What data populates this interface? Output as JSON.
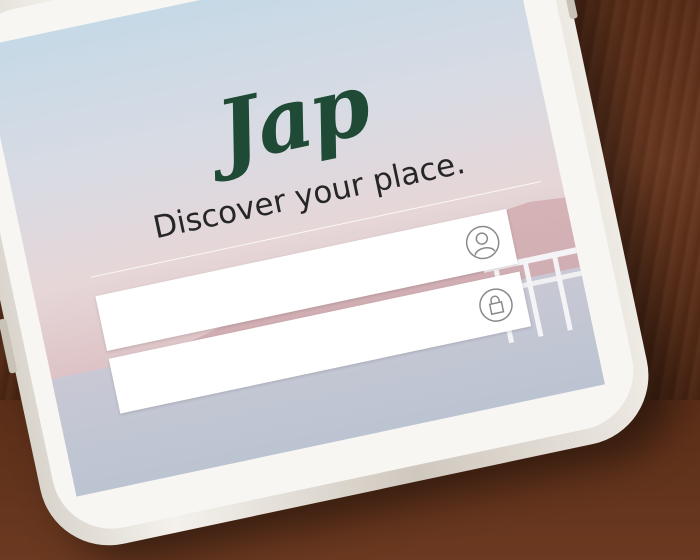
{
  "app": {
    "logo_text": "Jap",
    "tagline": "Discover your place."
  },
  "login": {
    "username_placeholder": "",
    "password_placeholder": "",
    "username_icon": "user-icon",
    "password_icon": "lock-icon"
  },
  "colors": {
    "brand_green": "#1e4a36",
    "tagline_text": "#262626",
    "sky_top": "#c6d9e6",
    "sky_bottom": "#ddc2c5",
    "wood": "#5a2e18"
  }
}
